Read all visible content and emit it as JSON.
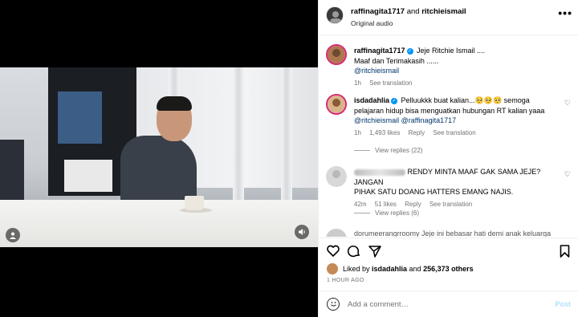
{
  "header": {
    "user1": "raffinagita1717",
    "and_text": " and ",
    "user2": "ritchieismail",
    "audio": "Original audio",
    "more": "•••"
  },
  "caption": {
    "username": "raffinagita1717",
    "line1": " Jeje Ritchie Ismail ....",
    "line2": "Maaf dan Terimakasih ......",
    "mention": "@ritchieismail",
    "time": "1h",
    "see_translation": "See translation"
  },
  "comment1": {
    "username": "isdadahlia",
    "line1": " Pelluukkk buat kalian...🥺🥺🥺 semoga",
    "line2": "pelajaran hidup bisa menguatkan hubungan RT kalian yaaa",
    "mention1": "@ritchieismail",
    "mention2": "@raffinagita1717",
    "time": "1h",
    "likes": "1,493 likes",
    "reply": "Reply",
    "see_translation": "See translation",
    "view_replies": "View replies (22)"
  },
  "comment2": {
    "text": "RENDY MINTA MAAF GAK SAMA JEJE? JANGAN",
    "line2": "PIHAK SATU DOANG HATTERS EMANG NAJIS.",
    "time": "42m",
    "likes": "51 likes",
    "reply": "Reply",
    "see_translation": "See translation",
    "view_replies": "View replies (6)"
  },
  "comment3": {
    "partial": "dorumeerangrroomy  Jeje ini bebasar hati demi anak keluarga"
  },
  "liked": {
    "prefix": "Liked by ",
    "user": "isdadahlia",
    "middle": " and ",
    "count": "256,373 others"
  },
  "time_ago": "1 HOUR AGO",
  "add_comment": {
    "placeholder": "Add a comment…",
    "post": "Post"
  },
  "icons": {
    "heart": "♡",
    "comment": "◯",
    "share": "➤",
    "bookmark": "🔖"
  }
}
